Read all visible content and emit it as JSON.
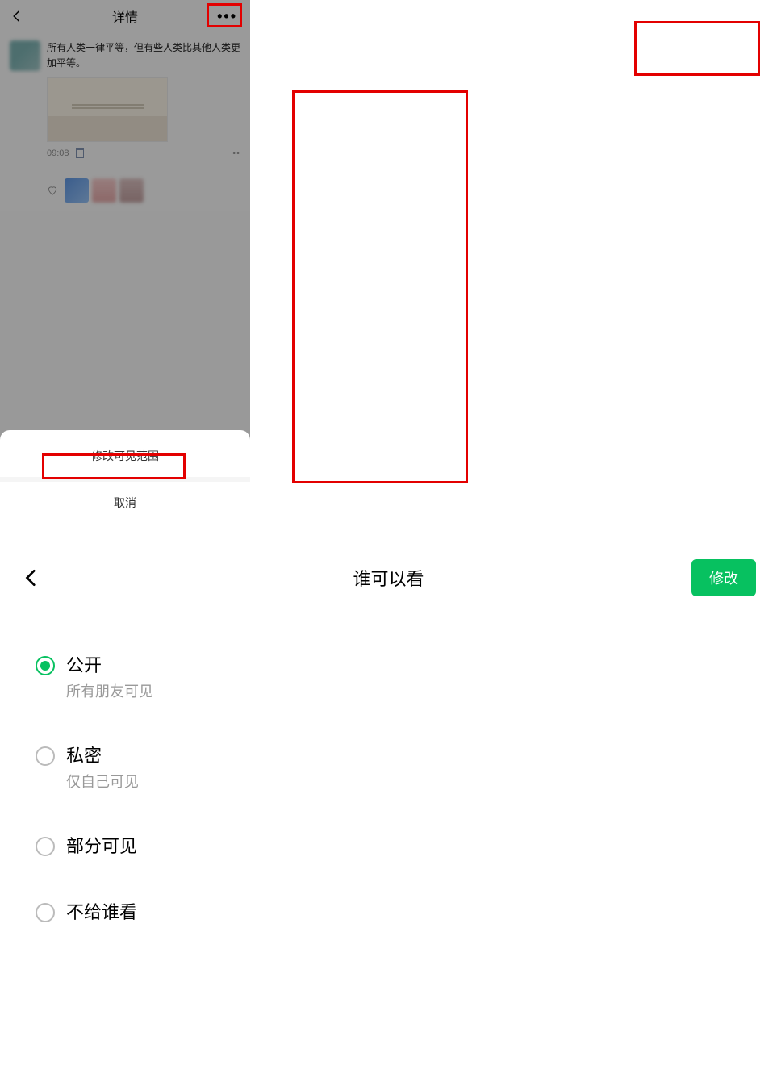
{
  "left": {
    "header": {
      "title": "详情"
    },
    "post": {
      "text": "所有人类一律平等，但有些人类比其他人类更加平等。",
      "time": "09:08"
    },
    "sheet": {
      "modify_label": "修改可见范围",
      "cancel_label": "取消"
    }
  },
  "right": {
    "header": {
      "title": "谁可以看",
      "modify_label": "修改"
    },
    "options": [
      {
        "label": "公开",
        "sub": "所有朋友可见",
        "selected": true
      },
      {
        "label": "私密",
        "sub": "仅自己可见",
        "selected": false
      },
      {
        "label": "部分可见",
        "sub": "",
        "selected": false
      },
      {
        "label": "不给谁看",
        "sub": "",
        "selected": false
      }
    ]
  },
  "colors": {
    "accent": "#07c160",
    "highlight": "#e30000"
  }
}
